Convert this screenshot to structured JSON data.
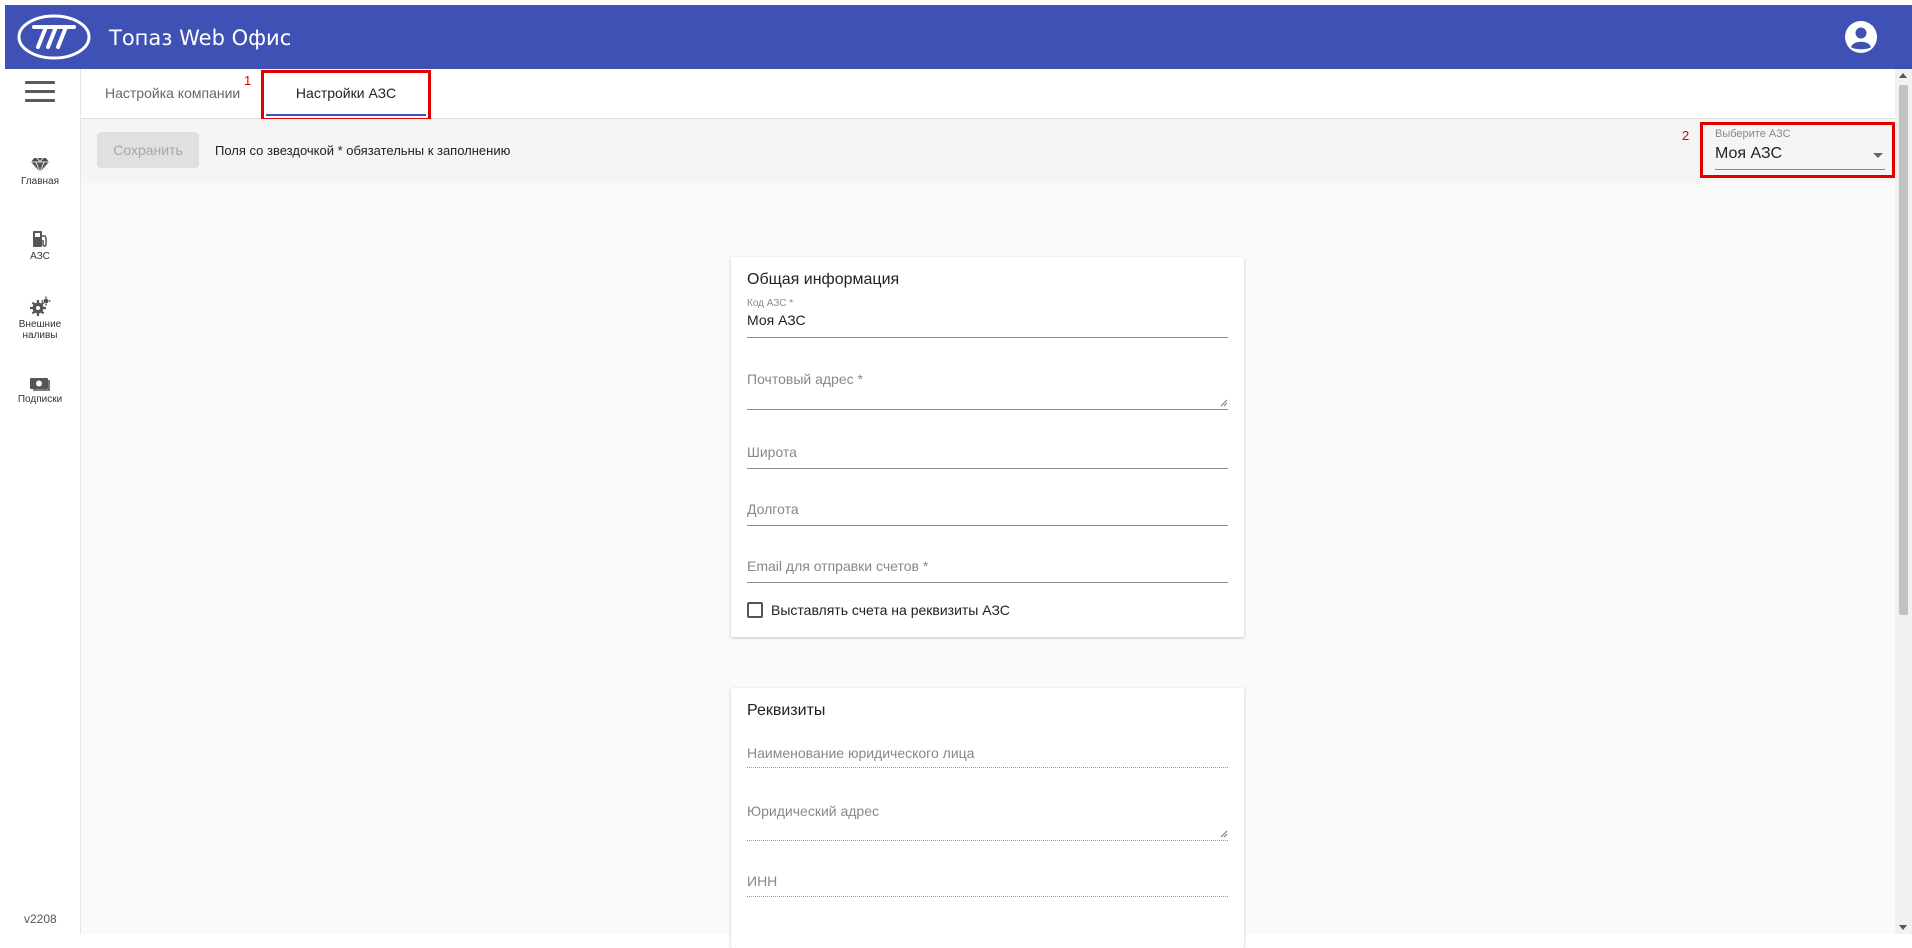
{
  "header": {
    "title": "Топаз Web Офис",
    "color": "#3f51b5",
    "logo_icon": "topaz-logo",
    "account_icon": "account-circle-icon"
  },
  "sidebar": {
    "menu_icon": "hamburger-menu-icon",
    "items": [
      {
        "label": "Главная",
        "icon": "diamond-icon"
      },
      {
        "label": "АЗС",
        "icon": "fuel-pump-icon"
      },
      {
        "label": "Внешние наливы",
        "icon": "gears-icon"
      },
      {
        "label": "Подписки",
        "icon": "camera-money-icon"
      }
    ],
    "version": "v2208"
  },
  "tabs": {
    "company": "Настройка компании",
    "azs": "Настройки АЗС",
    "active": "azs"
  },
  "annotations": {
    "one": "1",
    "two": "2",
    "color": "#e00000"
  },
  "toolbar": {
    "save_label": "Сохранить",
    "required_note": "Поля со звездочкой * обязательны к заполнению",
    "select_label": "Выберите АЗС",
    "select_value": "Моя АЗС"
  },
  "general": {
    "title": "Общая информация",
    "code_label": "Код АЗС *",
    "code_value": "Моя АЗС",
    "postal_label": "Почтовый адрес *",
    "latitude_label": "Широта",
    "longitude_label": "Долгота",
    "email_label": "Email для отправки счетов *",
    "checkbox_label": "Выставлять счета на реквизиты АЗС",
    "checkbox_checked": false
  },
  "requisites": {
    "title": "Реквизиты",
    "legal_name_label": "Наименование юридического лица",
    "legal_address_label": "Юридический адрес",
    "inn_label": "ИНН"
  }
}
